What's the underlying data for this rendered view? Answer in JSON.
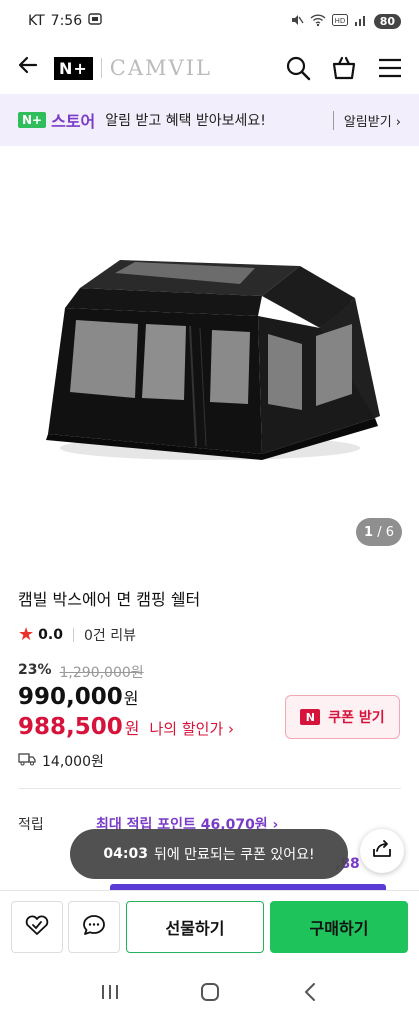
{
  "status_bar": {
    "carrier": "KT",
    "time": "7:56",
    "battery": "80"
  },
  "header": {
    "logo_box": "N+",
    "logo_text": "CAMVIL"
  },
  "promo": {
    "badge": "N+",
    "store": "스토어",
    "message": "알림 받고 혜택 받아보세요!",
    "alarm_label": "알림받기 ›"
  },
  "gallery": {
    "current": "1",
    "total": "/ 6"
  },
  "product": {
    "title": "캠빌 박스에어 면 캠핑 쉘터",
    "rating": "0.0",
    "reviews": "0건 리뷰",
    "discount_pct": "23%",
    "original_price": "1,290,000원",
    "price": "990,000",
    "price_unit": "원",
    "my_price": "988,500",
    "my_price_unit": "원",
    "my_price_link": "나의 할인가 ›",
    "coupon_label": "쿠폰 받기",
    "coupon_badge": "N",
    "shipping": "14,000원"
  },
  "points": {
    "label": "적립",
    "value": "최대 적립 포인트 46,070원 ›",
    "extra": ",88"
  },
  "toast": {
    "time": "04:03",
    "message": "뒤에 만료되는 쿠폰 있어요!"
  },
  "bottom_bar": {
    "gift_label": "선물하기",
    "buy_label": "구매하기"
  },
  "colors": {
    "accent_green": "#1fc35c",
    "store_purple": "#7a3cc8",
    "price_red": "#d6143b"
  }
}
